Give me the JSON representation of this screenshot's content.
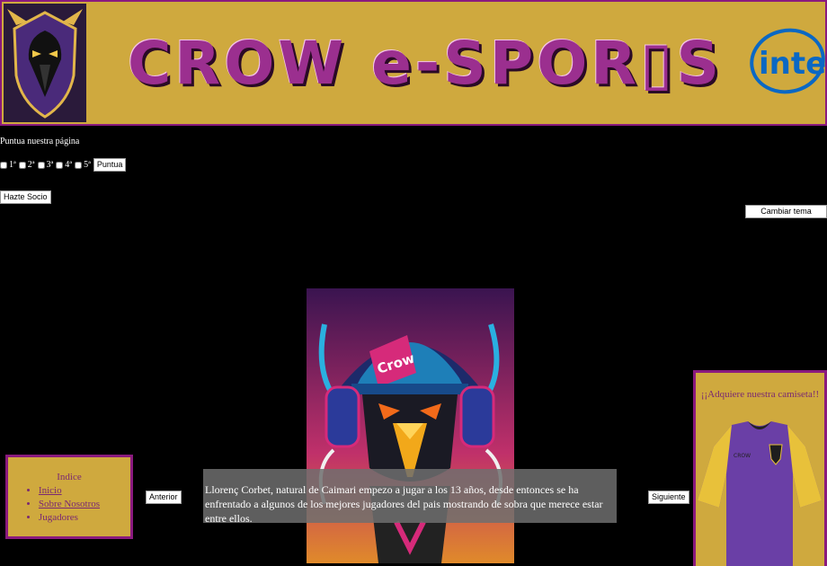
{
  "header": {
    "title": "CROW e-SPOR▯S",
    "sponsor": "intel"
  },
  "rating": {
    "title": "Puntua nuestra página",
    "options": [
      "1ª",
      "2ª",
      "3ª",
      "4ª",
      "5ª"
    ],
    "submit_label": "Puntua"
  },
  "actions": {
    "socio_label": "Hazte Socio",
    "theme_label": "Cambiar tema"
  },
  "hero": {
    "cap_text": "Crow"
  },
  "index": {
    "title": "Indice",
    "items": [
      "Inicio",
      "Sobre Nosotros",
      "Jugadores"
    ]
  },
  "carousel": {
    "prev_label": "Anterior",
    "next_label": "Siguiente",
    "caption": "Llorenç Corbet, natural de Caimari empezo a jugar a los 13 años, desde entonces se ha enfrentado a algunos de los mejores jugadores del pais mostrando de sobra que merece estar entre ellos."
  },
  "shop": {
    "title": "¡¡Adquiere nuestra camiseta!!",
    "shirt_text": "CROW"
  },
  "colors": {
    "gold": "#cfa93e",
    "purple_border": "#8a1a7e",
    "title_purple": "#9b2f8f",
    "intel_blue": "#0a68c4",
    "background": "#000000"
  }
}
